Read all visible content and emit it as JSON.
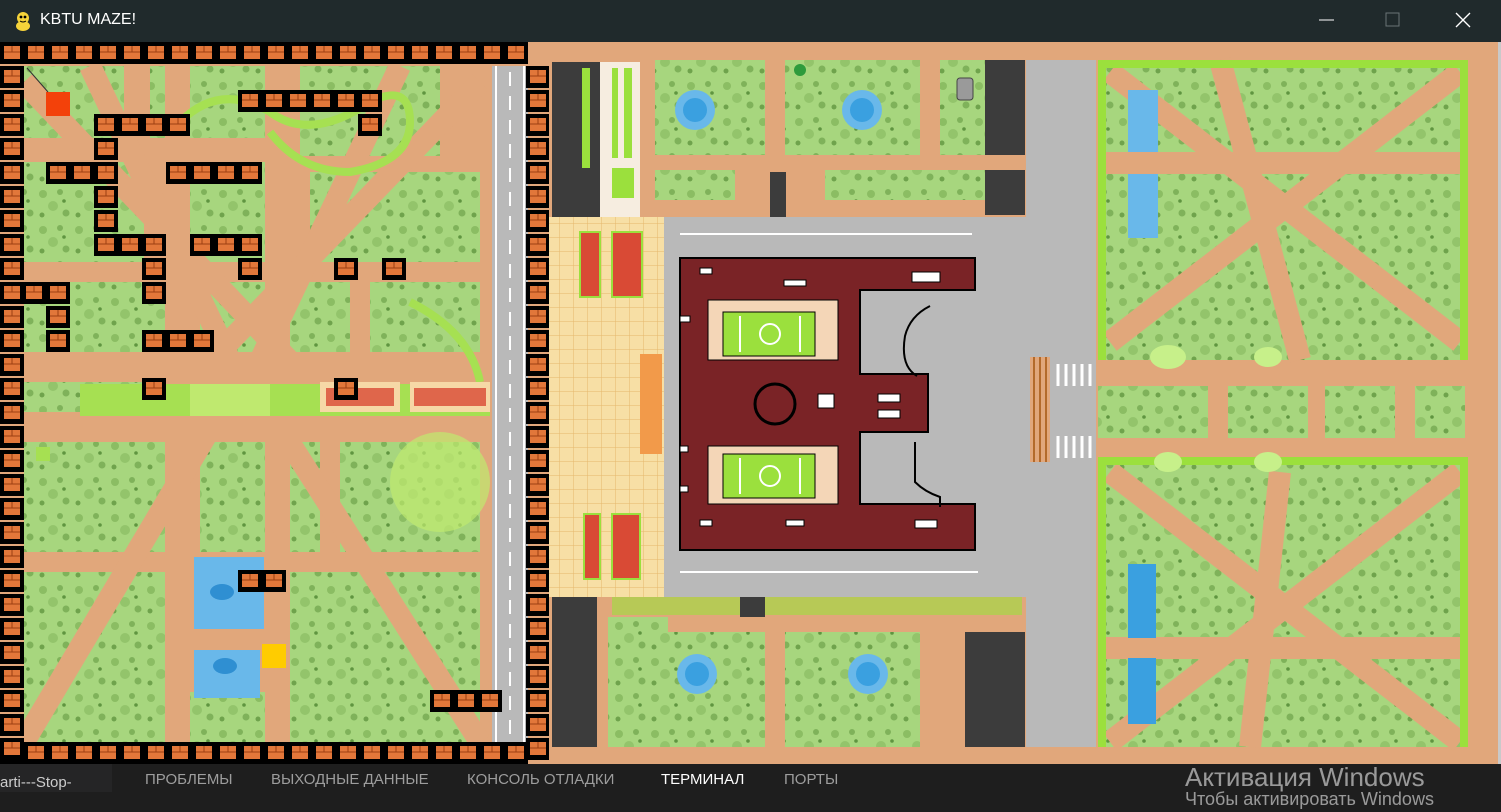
{
  "window": {
    "title": "KBTU MAZE!",
    "icon": "pygame-snake-icon",
    "controls": [
      "minimize-icon",
      "maximize-icon",
      "close-icon"
    ]
  },
  "game": {
    "player_color": "#f3410a",
    "goal_color": "#ffcc00",
    "wall_color": "#f06a2b"
  },
  "panel": {
    "side_text": "arti---Stop-",
    "tabs": [
      "ПРОБЛЕМЫ",
      "ВЫХОДНЫЕ ДАННЫЕ",
      "КОНСОЛЬ ОТЛАДКИ",
      "ТЕРМИНАЛ",
      "ПОРТЫ"
    ],
    "active_tab": "ТЕРМИНАЛ"
  },
  "watermark": {
    "title": "Активация Windows",
    "subtitle": "Чтобы активировать Windows"
  }
}
